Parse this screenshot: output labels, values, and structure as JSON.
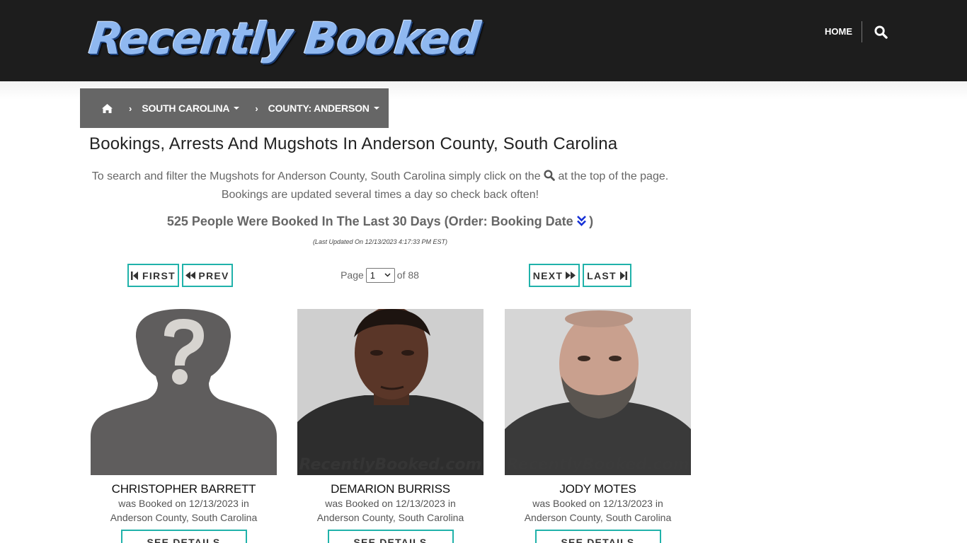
{
  "header": {
    "logo_text": "Recently Booked",
    "nav_home": "HOME",
    "search_icon": "search-icon"
  },
  "breadcrumb": {
    "home_icon": "home-icon",
    "state": "SOUTH CAROLINA",
    "county": "COUNTY: ANDERSON"
  },
  "page": {
    "title": "Bookings, Arrests And Mugshots In Anderson County, South Carolina",
    "intro_a": "To search and filter the Mugshots for Anderson County, South Carolina simply click on the",
    "intro_b": "at the top of the page. Bookings are updated several times a day so check back often!",
    "count_text": "525 People Were Booked In The Last 30 Days (Order: Booking Date",
    "count_close": ")",
    "updated": "(Last Updated On 12/13/2023 4:17:33 PM EST)"
  },
  "pagination": {
    "first": "FIRST",
    "prev": "PREV",
    "next": "NEXT",
    "last": "LAST",
    "page_label": "Page",
    "current_page": "1",
    "of_label": "of 88"
  },
  "bookings": [
    {
      "name": "CHRISTOPHER BARRETT",
      "line1": "was Booked on 12/13/2023 in",
      "line2": "Anderson County, South Carolina",
      "button": "SEE DETAILS"
    },
    {
      "name": "DEMARION BURRISS",
      "line1": "was Booked on 12/13/2023 in",
      "line2": "Anderson County, South Carolina",
      "button": "SEE DETAILS"
    },
    {
      "name": "JODY MOTES",
      "line1": "was Booked on 12/13/2023 in",
      "line2": "Anderson County, South Carolina",
      "button": "SEE DETAILS"
    }
  ],
  "watermark": "RecentlyBooked.com"
}
